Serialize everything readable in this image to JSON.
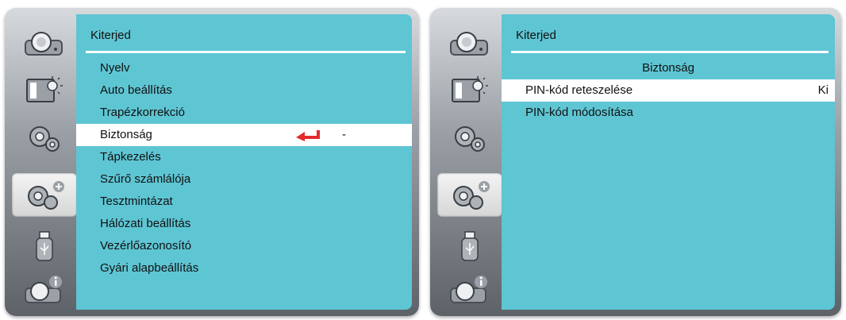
{
  "left_screen": {
    "title": "Kiterjed",
    "menu": [
      {
        "label": "Nyelv"
      },
      {
        "label": "Auto beállítás"
      },
      {
        "label": "Trapézkorrekció"
      },
      {
        "label": "Biztonság",
        "selected": true,
        "value": "-"
      },
      {
        "label": "Tápkezelés"
      },
      {
        "label": "Szűrő számlálója"
      },
      {
        "label": "Tesztmintázat"
      },
      {
        "label": "Hálózati beállítás"
      },
      {
        "label": "Vezérlőazonosító"
      },
      {
        "label": "Gyári alapbeállítás"
      }
    ]
  },
  "right_screen": {
    "title": "Kiterjed",
    "subheader": "Biztonság",
    "menu": [
      {
        "label": "PIN-kód reteszelése",
        "selected": true,
        "value": "Ki"
      },
      {
        "label": "PIN-kód módosítása"
      }
    ]
  },
  "sidebar_icons": [
    "source-icon",
    "picture-icon",
    "setup-icon",
    "extended-setup-icon",
    "usb-icon",
    "info-icon"
  ],
  "colors": {
    "panel": "#5ec5d3",
    "selection": "#ffffff",
    "enter_arrow": "#e32b2b"
  }
}
